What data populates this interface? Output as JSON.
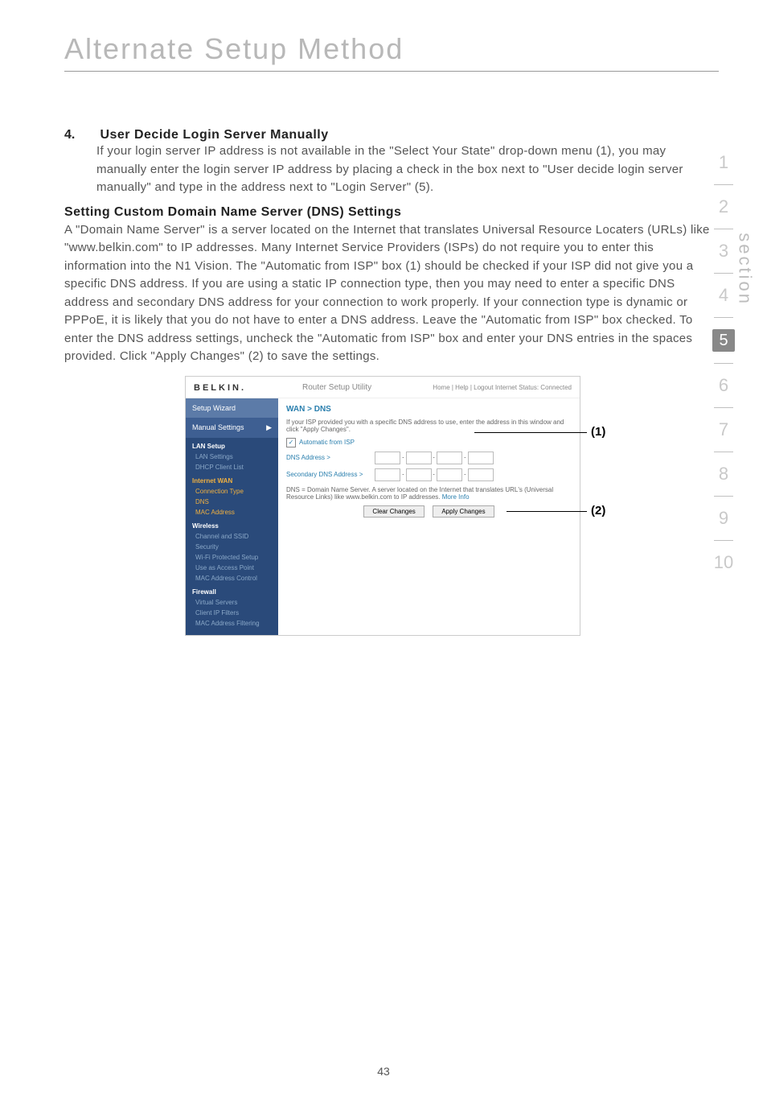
{
  "page_title": "Alternate Setup Method",
  "item4": {
    "num": "4.",
    "heading": "User Decide Login Server Manually",
    "body": "If your login server IP address is not available in the \"Select Your State\" drop-down menu (1), you may manually enter the login server IP address by placing a check in the box next to \"User decide login server manually\" and type in the address next to \"Login Server\" (5)."
  },
  "dns_heading": "Setting Custom Domain Name Server (DNS) Settings",
  "dns_body": "A \"Domain Name Server\" is a server located on the Internet that translates Universal Resource Locaters (URLs) like \"www.belkin.com\" to IP addresses. Many Internet Service Providers (ISPs) do not require you to enter this information into the N1 Vision. The \"Automatic from ISP\" box (1) should be checked if your ISP did not give you a specific DNS address. If you are using a static IP connection type, then you may need to enter a specific DNS address and secondary DNS address for your connection to work properly. If your connection type is dynamic or PPPoE, it is likely that you do not have to enter a DNS address. Leave the \"Automatic from ISP\" box checked. To enter the DNS address settings, uncheck the \"Automatic from ISP\" box and enter your DNS entries in the spaces provided. Click \"Apply Changes\" (2) to save the settings.",
  "side_nav": [
    "1",
    "2",
    "3",
    "4",
    "5",
    "6",
    "7",
    "8",
    "9",
    "10"
  ],
  "side_active_index": 4,
  "section_label": "section",
  "embed": {
    "brand": "BELKIN.",
    "utility": "Router Setup Utility",
    "header_right": "Home | Help | Logout   Internet Status: Connected",
    "sidebar": {
      "wizard": "Setup Wizard",
      "manual": "Manual Settings",
      "groups": [
        {
          "cat": "LAN Setup",
          "items": [
            "LAN Settings",
            "DHCP Client List"
          ]
        },
        {
          "cat": "Internet WAN",
          "hl": true,
          "items": [
            "Connection Type",
            "DNS",
            "MAC Address"
          ]
        },
        {
          "cat": "Wireless",
          "items": [
            "Channel and SSID",
            "Security",
            "Wi-Fi Protected Setup",
            "Use as Access Point",
            "MAC Address Control"
          ]
        },
        {
          "cat": "Firewall",
          "items": [
            "Virtual Servers",
            "Client IP Filters",
            "MAC Address Filtering"
          ]
        }
      ]
    },
    "main": {
      "crumb": "WAN > DNS",
      "desc": "If your ISP provided you with a specific DNS address to use, enter the address in this window and click \"Apply Changes\".",
      "auto_label": "Automatic from ISP",
      "dns_label": "DNS Address >",
      "sec_dns_label": "Secondary DNS Address >",
      "note_prefix": "DNS = Domain Name Server. A server located on the Internet that translates URL's (Universal Resource Links) like www.belkin.com to IP addresses. ",
      "note_link": "More Info",
      "clear": "Clear Changes",
      "apply": "Apply Changes"
    }
  },
  "callouts": {
    "c1": "(1)",
    "c2": "(2)"
  },
  "page_number": "43"
}
